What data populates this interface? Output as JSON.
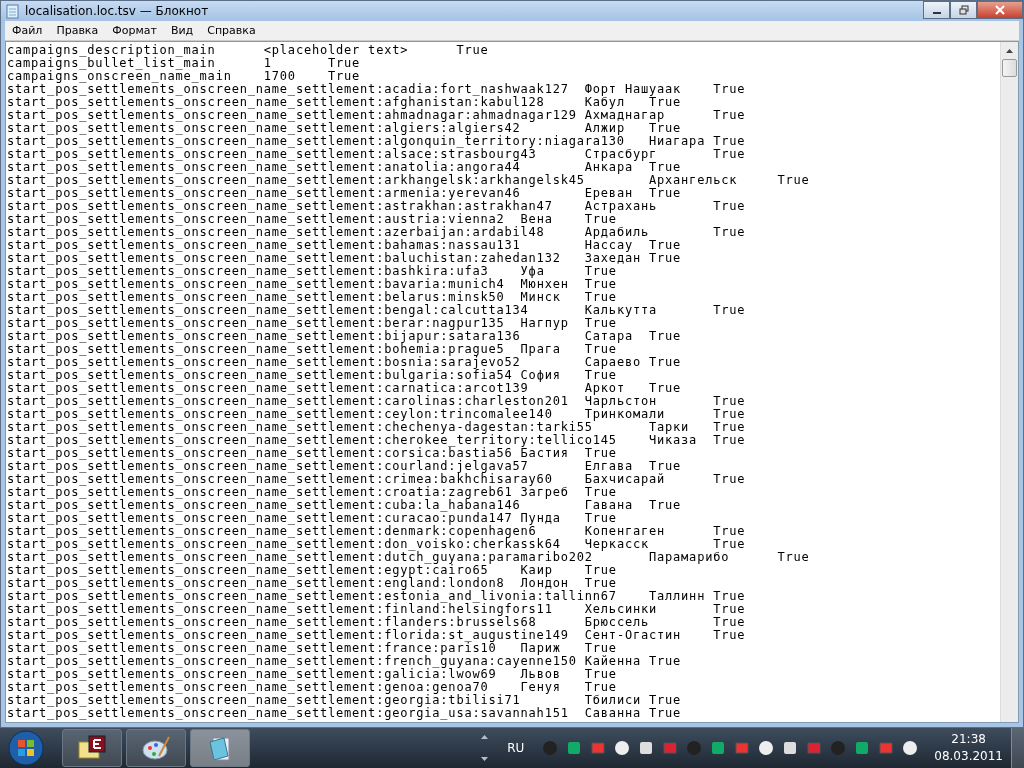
{
  "window": {
    "title": "localisation.loc.tsv — Блокнот"
  },
  "menu": [
    "Файл",
    "Правка",
    "Формат",
    "Вид",
    "Справка"
  ],
  "lines": [
    [
      "campaigns_description_main",
      "<placeholder text>",
      "True"
    ],
    [
      "campaigns_bullet_list_main",
      "1",
      "True"
    ],
    [
      "campaigns_onscreen_name_main",
      "1700",
      "True"
    ],
    [
      "start_pos_settlements_onscreen_name_settlement:acadia:fort_nashwaak127",
      "Форт Нашуаак",
      "True"
    ],
    [
      "start_pos_settlements_onscreen_name_settlement:afghanistan:kabul128",
      "Кабул",
      "True"
    ],
    [
      "start_pos_settlements_onscreen_name_settlement:ahmadnagar:ahmadnagar129",
      "Ахмаднагар",
      "True"
    ],
    [
      "start_pos_settlements_onscreen_name_settlement:algiers:algiers42",
      "Алжир",
      "True"
    ],
    [
      "start_pos_settlements_onscreen_name_settlement:algonquin_territory:niagara130",
      "Ниагара",
      "True"
    ],
    [
      "start_pos_settlements_onscreen_name_settlement:alsace:strasbourg43",
      "Страсбург",
      "True"
    ],
    [
      "start_pos_settlements_onscreen_name_settlement:anatolia:angora44",
      "Анкара",
      "True"
    ],
    [
      "start_pos_settlements_onscreen_name_settlement:arkhangelsk:arkhangelsk45",
      "Архангельск",
      "True"
    ],
    [
      "start_pos_settlements_onscreen_name_settlement:armenia:yerevan46",
      "Ереван",
      "True"
    ],
    [
      "start_pos_settlements_onscreen_name_settlement:astrakhan:astrakhan47",
      "Астрахань",
      "True"
    ],
    [
      "start_pos_settlements_onscreen_name_settlement:austria:vienna2",
      "Вена",
      "True"
    ],
    [
      "start_pos_settlements_onscreen_name_settlement:azerbaijan:ardabil48",
      "Ардабиль",
      "True"
    ],
    [
      "start_pos_settlements_onscreen_name_settlement:bahamas:nassau131",
      "Нассау",
      "True"
    ],
    [
      "start_pos_settlements_onscreen_name_settlement:baluchistan:zahedan132",
      "Захедан",
      "True"
    ],
    [
      "start_pos_settlements_onscreen_name_settlement:bashkira:ufa3",
      "Уфа",
      "True"
    ],
    [
      "start_pos_settlements_onscreen_name_settlement:bavaria:munich4",
      "Мюнхен",
      "True"
    ],
    [
      "start_pos_settlements_onscreen_name_settlement:belarus:minsk50",
      "Минск",
      "True"
    ],
    [
      "start_pos_settlements_onscreen_name_settlement:bengal:calcutta134",
      "Калькутта",
      "True"
    ],
    [
      "start_pos_settlements_onscreen_name_settlement:berar:nagpur135",
      "Нагпур",
      "True"
    ],
    [
      "start_pos_settlements_onscreen_name_settlement:bijapur:satara136",
      "Сатара",
      "True"
    ],
    [
      "start_pos_settlements_onscreen_name_settlement:bohemia:prague5",
      "Прага",
      "True"
    ],
    [
      "start_pos_settlements_onscreen_name_settlement:bosnia:sarajevo52",
      "Сараево",
      "True"
    ],
    [
      "start_pos_settlements_onscreen_name_settlement:bulgaria:sofia54",
      "София",
      "True"
    ],
    [
      "start_pos_settlements_onscreen_name_settlement:carnatica:arcot139",
      "Аркот",
      "True"
    ],
    [
      "start_pos_settlements_onscreen_name_settlement:carolinas:charleston201",
      "Чарльстон",
      "True"
    ],
    [
      "start_pos_settlements_onscreen_name_settlement:ceylon:trincomalee140",
      "Тринкомали",
      "True"
    ],
    [
      "start_pos_settlements_onscreen_name_settlement:chechenya-dagestan:tarki55",
      "Тарки",
      "True"
    ],
    [
      "start_pos_settlements_onscreen_name_settlement:cherokee_territory:tellico145",
      "Чиказа",
      "True"
    ],
    [
      "start_pos_settlements_onscreen_name_settlement:corsica:bastia56",
      "Бастия",
      "True"
    ],
    [
      "start_pos_settlements_onscreen_name_settlement:courland:jelgava57",
      "Елгава",
      "True"
    ],
    [
      "start_pos_settlements_onscreen_name_settlement:crimea:bakhchisaray60",
      "Бахчисарай",
      "True"
    ],
    [
      "start_pos_settlements_onscreen_name_settlement:croatia:zagreb61",
      "Загреб",
      "True"
    ],
    [
      "start_pos_settlements_onscreen_name_settlement:cuba:la_habana146",
      "Гавана",
      "True"
    ],
    [
      "start_pos_settlements_onscreen_name_settlement:curacao:punda147",
      "Пунда",
      "True"
    ],
    [
      "start_pos_settlements_onscreen_name_settlement:denmark:copenhagen6",
      "Копенгаген",
      "True"
    ],
    [
      "start_pos_settlements_onscreen_name_settlement:don_voisko:cherkassk64",
      "Черкасск",
      "True"
    ],
    [
      "start_pos_settlements_onscreen_name_settlement:dutch_guyana:paramaribo202",
      "Парамарибо",
      "True"
    ],
    [
      "start_pos_settlements_onscreen_name_settlement:egypt:cairo65",
      "Каир",
      "True"
    ],
    [
      "start_pos_settlements_onscreen_name_settlement:england:london8",
      "Лондон",
      "True"
    ],
    [
      "start_pos_settlements_onscreen_name_settlement:estonia_and_livonia:tallinn67",
      "Таллинн",
      "True"
    ],
    [
      "start_pos_settlements_onscreen_name_settlement:finland:helsingfors11",
      "Хельсинки",
      "True"
    ],
    [
      "start_pos_settlements_onscreen_name_settlement:flanders:brussels68",
      "Брюссель",
      "True"
    ],
    [
      "start_pos_settlements_onscreen_name_settlement:florida:st_augustine149",
      "Сент-Огастин",
      "True"
    ],
    [
      "start_pos_settlements_onscreen_name_settlement:france:paris10",
      "Париж",
      "True"
    ],
    [
      "start_pos_settlements_onscreen_name_settlement:french_guyana:cayenne150",
      "Кайенна",
      "True"
    ],
    [
      "start_pos_settlements_onscreen_name_settlement:galicia:lwow69",
      "Львов",
      "True"
    ],
    [
      "start_pos_settlements_onscreen_name_settlement:genoa:genoa70",
      "Генуя",
      "True"
    ],
    [
      "start_pos_settlements_onscreen_name_settlement:georgia:tbilisi71",
      "Тбилиси",
      "True"
    ],
    [
      "start_pos_settlements_onscreen_name_settlement:georgia_usa:savannah151",
      "Саванна",
      "True"
    ]
  ],
  "taskbar": {
    "language": "RU",
    "time": "21:38",
    "date": "08.03.2011"
  }
}
